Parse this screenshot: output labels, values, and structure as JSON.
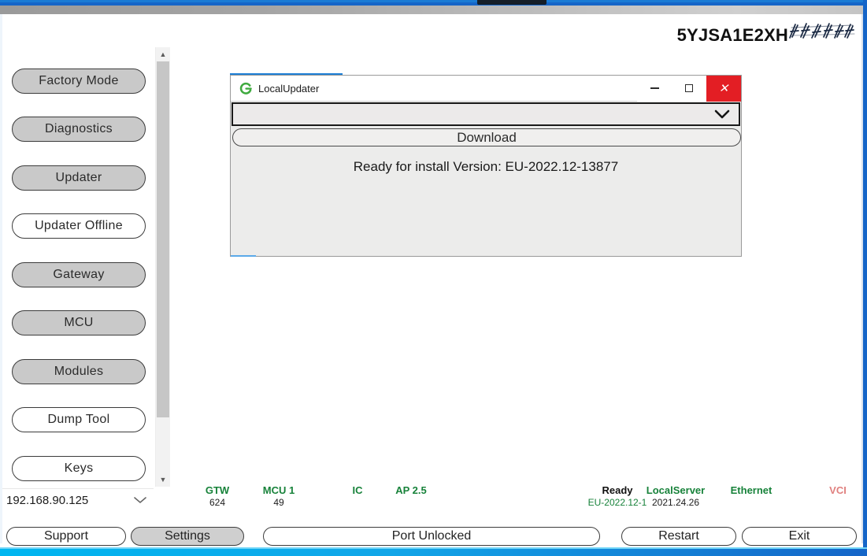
{
  "window": {
    "vin": "5YJSA1E2XH",
    "vin_redacted_note": "redacted"
  },
  "sidebar": {
    "items": [
      {
        "label": "Factory Mode",
        "state": "gray"
      },
      {
        "label": "Diagnostics",
        "state": "gray"
      },
      {
        "label": "Updater",
        "state": "gray"
      },
      {
        "label": "Updater Offline",
        "state": "white"
      },
      {
        "label": "Gateway",
        "state": "gray"
      },
      {
        "label": "MCU",
        "state": "gray"
      },
      {
        "label": "Modules",
        "state": "gray"
      },
      {
        "label": "Dump Tool",
        "state": "white"
      },
      {
        "label": "Keys",
        "state": "white"
      }
    ],
    "ip_select": {
      "value": "192.168.90.125",
      "caret_icon": "chevron-down-icon"
    },
    "scrollbar": {
      "up_icon": "chevron-up-icon",
      "down_icon": "chevron-down-icon"
    }
  },
  "dialog": {
    "title": "LocalUpdater",
    "app_icon": "localupdater-logo-icon",
    "titlebar": {
      "minimize_icon": "minimize-icon",
      "maximize_icon": "maximize-icon",
      "close_icon": "close-icon",
      "close_color": "#e31e24"
    },
    "combo": {
      "value": "",
      "placeholder": "",
      "caret_icon": "chevron-down-icon"
    },
    "download_label": "Download",
    "status_text": "Ready for install Version: EU-2022.12-13877"
  },
  "statusbar": {
    "items": [
      {
        "name": "GTW",
        "value": "624",
        "color": "#17823a",
        "value_color": "#1c1c1c"
      },
      {
        "name": "MCU 1",
        "value": "49",
        "color": "#17823a",
        "value_color": "#1c1c1c"
      },
      {
        "name": "IC",
        "value": "",
        "color": "#17823a",
        "value_color": "#1c1c1c"
      },
      {
        "name": "AP 2.5",
        "value": "",
        "color": "#17823a",
        "value_color": "#1c1c1c"
      },
      {
        "name": "Ready",
        "value": "EU-2022.12-1",
        "color": "#111111",
        "value_color": "#17823a"
      },
      {
        "name": "LocalServer",
        "value": "2021.24.26",
        "color": "#17823a",
        "value_color": "#1c1c1c"
      },
      {
        "name": "Ethernet",
        "value": "",
        "color": "#17823a",
        "value_color": "#1c1c1c"
      },
      {
        "name": "VCI",
        "value": "",
        "color": "#e0807f",
        "value_color": "#1c1c1c"
      }
    ]
  },
  "bottom_bar": {
    "support": "Support",
    "settings": "Settings",
    "port": "Port Unlocked",
    "restart": "Restart",
    "exit": "Exit"
  }
}
